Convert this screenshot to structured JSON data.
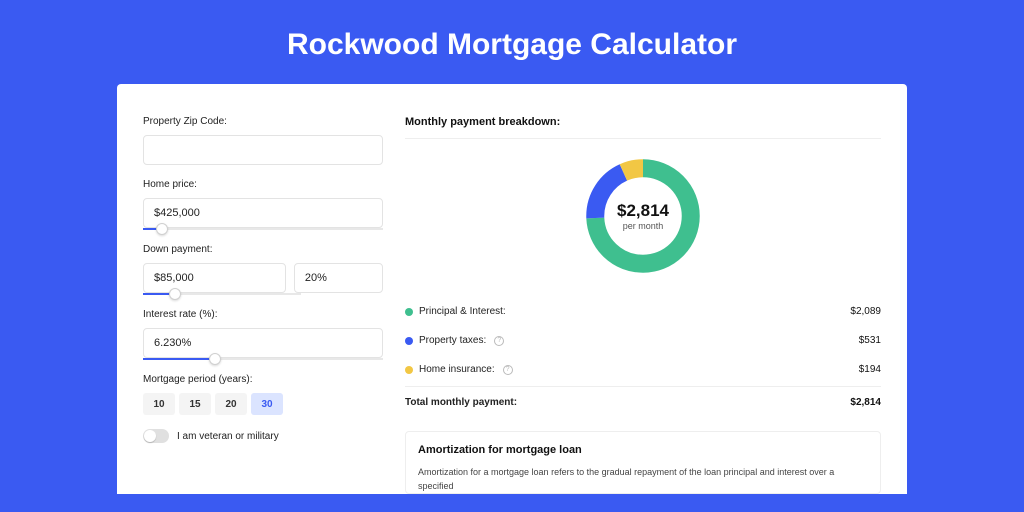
{
  "page_title": "Rockwood Mortgage Calculator",
  "form": {
    "zip_label": "Property Zip Code:",
    "zip_value": "",
    "home_price_label": "Home price:",
    "home_price_value": "$425,000",
    "down_payment_label": "Down payment:",
    "down_payment_value": "$85,000",
    "down_payment_pct": "20%",
    "interest_label": "Interest rate (%):",
    "interest_value": "6.230%",
    "period_label": "Mortgage period (years):",
    "period_options": [
      "10",
      "15",
      "20",
      "30"
    ],
    "period_selected": "30",
    "veteran_label": "I am veteran or military"
  },
  "breakdown": {
    "title": "Monthly payment breakdown:",
    "center_amount": "$2,814",
    "center_sub": "per month",
    "principal_label": "Principal & Interest:",
    "principal_value": "$2,089",
    "taxes_label": "Property taxes:",
    "taxes_value": "$531",
    "insurance_label": "Home insurance:",
    "insurance_value": "$194",
    "total_label": "Total monthly payment:",
    "total_value": "$2,814"
  },
  "amort": {
    "title": "Amortization for mortgage loan",
    "body": "Amortization for a mortgage loan refers to the gradual repayment of the loan principal and interest over a specified"
  },
  "colors": {
    "accent": "#3A5AF2",
    "green": "#3FBF8F",
    "yellow": "#F2C744"
  },
  "chart_data": {
    "type": "pie",
    "title": "Monthly payment breakdown",
    "series": [
      {
        "name": "Principal & Interest",
        "value": 2089,
        "color": "#3FBF8F"
      },
      {
        "name": "Property taxes",
        "value": 531,
        "color": "#3A5AF2"
      },
      {
        "name": "Home insurance",
        "value": 194,
        "color": "#F2C744"
      }
    ],
    "total": 2814,
    "unit": "$ per month"
  }
}
